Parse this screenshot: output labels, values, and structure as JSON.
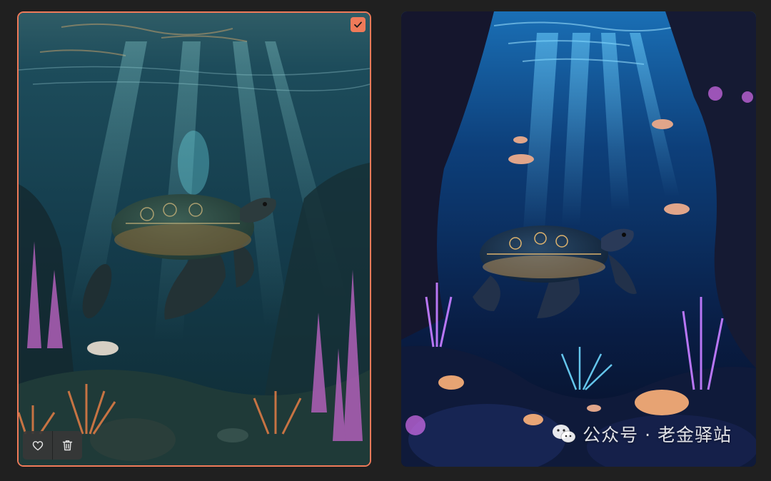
{
  "gallery": {
    "images": [
      {
        "kind": "generated-image",
        "style": "realistic",
        "selected": true
      },
      {
        "kind": "generated-image",
        "style": "neon-glow",
        "selected": false
      }
    ]
  },
  "watermark": {
    "icon": "wechat-icon",
    "text": "公众号 · 老金驿站"
  },
  "icons": {
    "select": "checkmark-icon",
    "favorite": "heart-icon",
    "delete": "trash-icon"
  },
  "colors": {
    "background": "#202020",
    "accent": "#ef7a59"
  }
}
